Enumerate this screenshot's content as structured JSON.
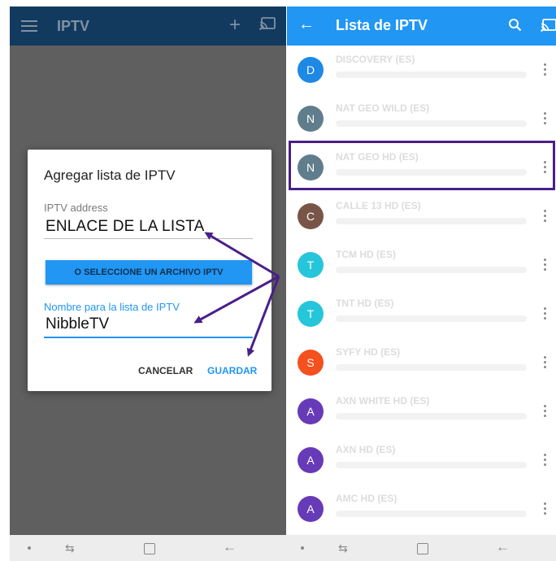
{
  "left": {
    "app_title": "IPTV",
    "dialog": {
      "title": "Agregar lista de IPTV",
      "address_label": "IPTV address",
      "address_value": "ENLACE DE LA LISTA",
      "file_button": "O SELECCIONE UN ARCHIVO IPTV",
      "name_label": "Nombre para la lista de IPTV",
      "name_value": "NibbleTV",
      "cancel_label": "CANCELAR",
      "save_label": "GUARDAR"
    }
  },
  "right": {
    "app_title": "Lista de IPTV",
    "channels": [
      {
        "initial": "D",
        "name": "DISCOVERY (ES)",
        "color": "#1e88e5"
      },
      {
        "initial": "N",
        "name": "NAT GEO WILD (ES)",
        "color": "#607d8b"
      },
      {
        "initial": "N",
        "name": "NAT GEO HD (ES)",
        "color": "#607d8b"
      },
      {
        "initial": "C",
        "name": "CALLE 13 HD (ES)",
        "color": "#795548"
      },
      {
        "initial": "T",
        "name": "TCM HD (ES)",
        "color": "#26c6da"
      },
      {
        "initial": "T",
        "name": "TNT HD (ES)",
        "color": "#26c6da"
      },
      {
        "initial": "S",
        "name": "SYFY HD (ES)",
        "color": "#f4511e"
      },
      {
        "initial": "A",
        "name": "AXN WHITE HD (ES)",
        "color": "#673ab7"
      },
      {
        "initial": "A",
        "name": "AXN HD (ES)",
        "color": "#673ab7"
      },
      {
        "initial": "A",
        "name": "AMC HD (ES)",
        "color": "#673ab7"
      }
    ]
  },
  "colors": {
    "left_appbar": "#123a5e",
    "right_appbar": "#2196f3",
    "accent": "#2196f3",
    "annotation": "#4a1f8a"
  }
}
